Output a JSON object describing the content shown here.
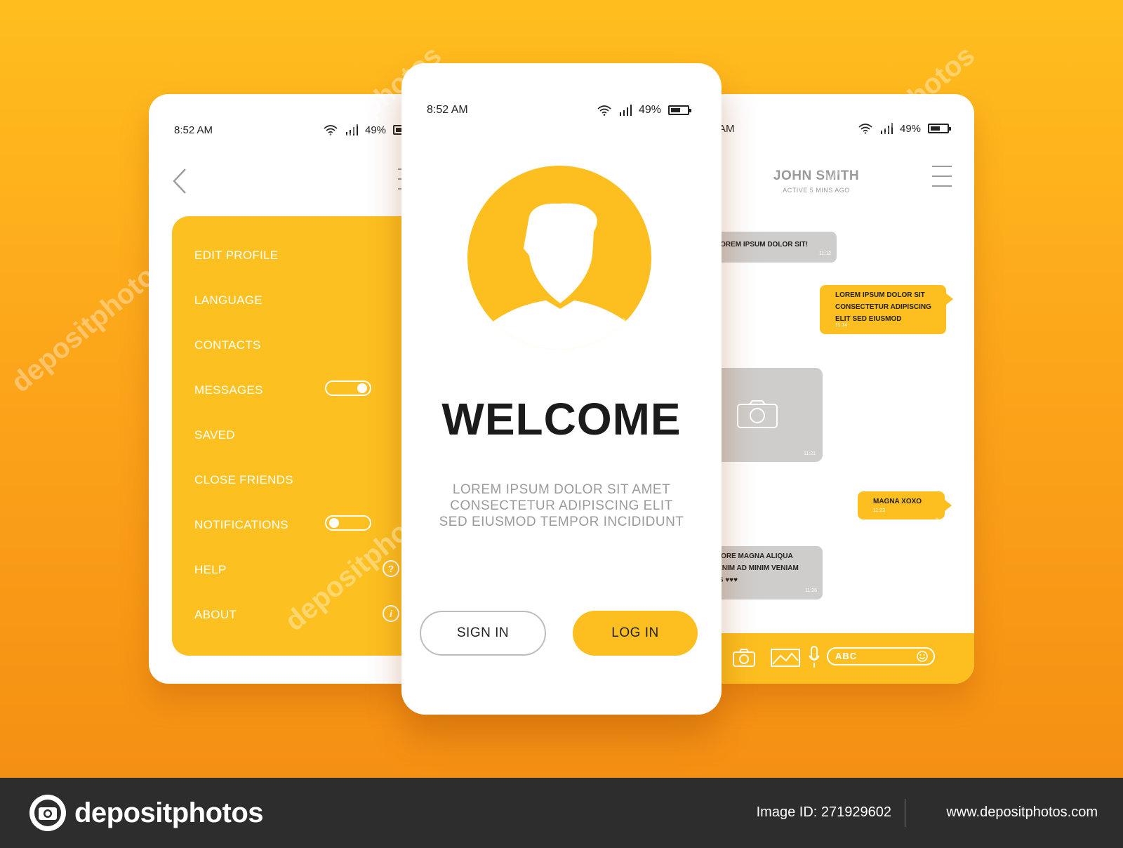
{
  "colors": {
    "accent": "#fcbf1f",
    "background": "#fca41a",
    "bubble_gray": "#cfcdcb",
    "footer": "#2d2d2d"
  },
  "left_phone": {
    "status": {
      "time": "8:52 AM",
      "battery": "49%",
      "battery_level": 0.49
    },
    "menu_items": [
      {
        "label": "EDIT PROFILE"
      },
      {
        "label": "LANGUAGE"
      },
      {
        "label": "CONTACTS"
      },
      {
        "label": "MESSAGES",
        "control": "toggle",
        "on": true
      },
      {
        "label": "SAVED"
      },
      {
        "label": "CLOSE FRIENDS"
      },
      {
        "label": "NOTIFICATIONS",
        "control": "toggle",
        "on": false
      },
      {
        "label": "HELP",
        "icon": "help-icon",
        "glyph": "?"
      },
      {
        "label": "ABOUT",
        "icon": "info-icon",
        "glyph": "i"
      }
    ]
  },
  "center_phone": {
    "status": {
      "time": "8:52 AM",
      "battery": "49%",
      "battery_level": 0.49
    },
    "title": "WELCOME",
    "body_lines": [
      "LOREM IPSUM DOLOR SIT AMET",
      "CONSECTETUR ADIPISCING ELIT",
      "SED EIUSMOD TEMPOR INCIDIDUNT"
    ],
    "sign_in_label": "SIGN IN",
    "log_in_label": "LOG IN"
  },
  "right_phone": {
    "status": {
      "time": "8:52 AM",
      "time_visible": "52 AM",
      "battery": "49%",
      "battery_level": 0.49
    },
    "contact_name": "JOHN SMITH",
    "active_status": "ACTIVE 5 MINS AGO",
    "messages": [
      {
        "dir": "in",
        "lines": [
          "LOREM IPSUM DOLOR SIT!"
        ],
        "time": "11:12"
      },
      {
        "dir": "out",
        "lines": [
          "LOREM IPSUM DOLOR SIT",
          "CONSECTETUR ADIPISCING",
          "ELIT SED EIUSMOD"
        ],
        "time": "11:14"
      },
      {
        "dir": "in",
        "type": "photo",
        "time": "11:21"
      },
      {
        "dir": "out",
        "lines": [
          "MAGNA XOXO"
        ],
        "time": "11:23"
      },
      {
        "dir": "in",
        "lines": [
          "DOLORE MAGNA ALIQUA",
          "UT ENIM AD MINIM VENIAM",
          "QUIS ♥♥♥"
        ],
        "time": "11:26"
      }
    ],
    "composer_placeholder": "ABC"
  },
  "watermark": "depositphotos",
  "footer": {
    "brand": "depositphotos",
    "image_id": "Image ID: 271929602",
    "site": "www.depositphotos.com"
  }
}
